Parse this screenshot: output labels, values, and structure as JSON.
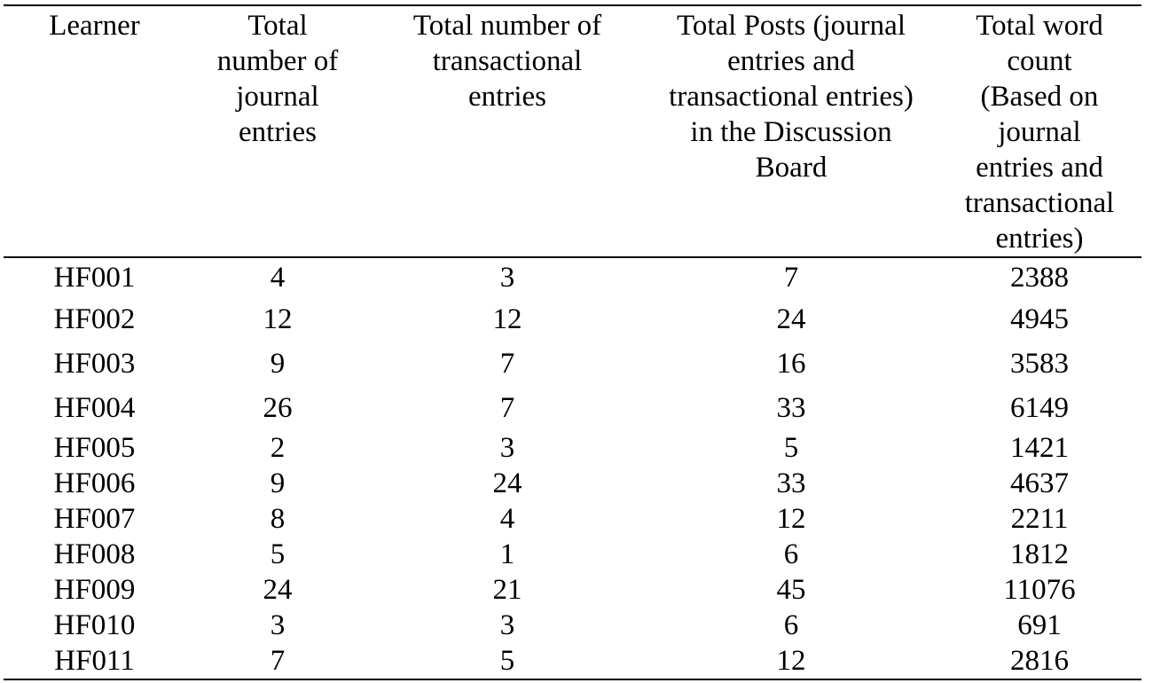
{
  "table": {
    "columns": [
      {
        "key": "learner",
        "lines": [
          "Learner"
        ]
      },
      {
        "key": "journal",
        "lines": [
          "Total",
          "number of",
          "journal",
          "entries"
        ]
      },
      {
        "key": "transactional",
        "lines": [
          "Total number of",
          "transactional",
          "entries"
        ]
      },
      {
        "key": "posts",
        "lines": [
          "Total Posts (journal",
          "entries and",
          "transactional entries)",
          "in the Discussion",
          "Board"
        ]
      },
      {
        "key": "words",
        "lines": [
          "Total word",
          "count",
          "(Based on",
          "journal",
          "entries and",
          "transactional",
          "entries)"
        ]
      }
    ],
    "rows": [
      [
        "HF001",
        "4",
        "3",
        "7",
        "2388"
      ],
      [
        "HF002",
        "12",
        "12",
        "24",
        "4945"
      ],
      [
        "HF003",
        "9",
        "7",
        "16",
        "3583"
      ],
      [
        "HF004",
        "26",
        "7",
        "33",
        "6149"
      ],
      [
        "HF005",
        "2",
        "3",
        "5",
        "1421"
      ],
      [
        "HF006",
        "9",
        "24",
        "33",
        "4637"
      ],
      [
        "HF007",
        "8",
        "4",
        "12",
        "2211"
      ],
      [
        "HF008",
        "5",
        "1",
        "6",
        "1812"
      ],
      [
        "HF009",
        "24",
        "21",
        "45",
        "11076"
      ],
      [
        "HF010",
        "3",
        "3",
        "6",
        "691"
      ],
      [
        "HF011",
        "7",
        "5",
        "12",
        "2816"
      ]
    ]
  },
  "chart_data": {
    "type": "table",
    "title": "",
    "headers": [
      "Learner",
      "Total number of journal entries",
      "Total number of transactional entries",
      "Total Posts (journal entries and transactional entries) in the Discussion Board",
      "Total word count (Based on journal entries and transactional entries)"
    ],
    "rows": [
      [
        "HF001",
        4,
        3,
        7,
        2388
      ],
      [
        "HF002",
        12,
        12,
        24,
        4945
      ],
      [
        "HF003",
        9,
        7,
        16,
        3583
      ],
      [
        "HF004",
        26,
        7,
        33,
        6149
      ],
      [
        "HF005",
        2,
        3,
        5,
        1421
      ],
      [
        "HF006",
        9,
        24,
        33,
        4637
      ],
      [
        "HF007",
        8,
        4,
        12,
        2211
      ],
      [
        "HF008",
        5,
        1,
        6,
        1812
      ],
      [
        "HF009",
        24,
        21,
        45,
        11076
      ],
      [
        "HF010",
        3,
        3,
        6,
        691
      ],
      [
        "HF011",
        7,
        5,
        12,
        2816
      ]
    ]
  }
}
